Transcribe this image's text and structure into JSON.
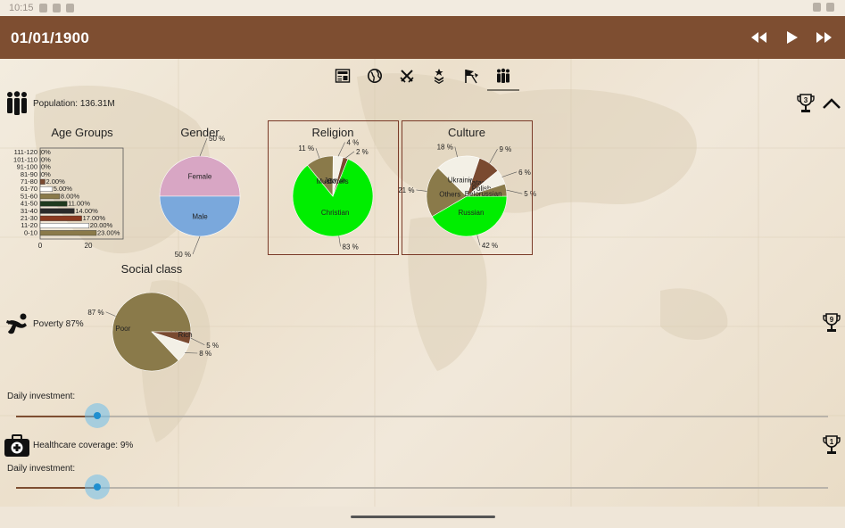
{
  "app_bar": {
    "date": "01/01/1900",
    "bg_color": "#7e4e31"
  },
  "status_bar": {
    "time": "10:15"
  },
  "tabs": [
    {
      "icon": "newspaper-icon"
    },
    {
      "icon": "globe-icon"
    },
    {
      "icon": "crossed-swords-icon"
    },
    {
      "icon": "military-rank-icon"
    },
    {
      "icon": "flags-icon"
    },
    {
      "icon": "people-icon",
      "active": true
    }
  ],
  "population": {
    "label": "Population: 136.31M",
    "trophy_rank": "3"
  },
  "poverty": {
    "label": "Poverty 87%",
    "trophy_rank": "9",
    "investment_label": "Daily investment:",
    "investment_level": 0.1
  },
  "healthcare": {
    "label": "Healthcare coverage: 9%",
    "trophy_rank": "1",
    "investment_label": "Daily investment:",
    "investment_level": 0.1
  },
  "chart_data": [
    {
      "type": "bar",
      "orientation": "horizontal",
      "title": "Age Groups",
      "categories": [
        "111-120",
        "101-110",
        "91-100",
        "81-90",
        "71-80",
        "61-70",
        "51-60",
        "41-50",
        "31-40",
        "21-30",
        "11-20",
        "0-10"
      ],
      "values": [
        0,
        0,
        0,
        0,
        2,
        5,
        8,
        11,
        14,
        17,
        20,
        23
      ],
      "value_labels": [
        "0%",
        "0%",
        "0%",
        "0%",
        "2.00%",
        "5.00%",
        "8.00%",
        "11.00%",
        "14.00%",
        "17.00%",
        "20.00%",
        "23.00%"
      ],
      "colors": [
        "#8a7a4a",
        "#ffffff",
        "#ffffff",
        "#8a7a4a",
        "#7a4a30",
        "#ffffff",
        "#8a7a4a",
        "#1f3a1f",
        "#2a2a2a",
        "#8a3a20",
        "#ffffff",
        "#8a7a4a"
      ],
      "xlim": [
        0,
        23
      ],
      "xticks": [
        "0",
        "20"
      ]
    },
    {
      "type": "pie",
      "title": "Gender",
      "labels": [
        "Female",
        "Male"
      ],
      "values": [
        50,
        50
      ],
      "value_labels": [
        "50 %",
        "50 %"
      ],
      "colors": [
        "#d8a6c4",
        "#7aa8dc"
      ]
    },
    {
      "type": "pie",
      "title": "Religion",
      "labels": [
        "Christian",
        "Muslim",
        "Jewish",
        "Others"
      ],
      "values": [
        83,
        11,
        4,
        2
      ],
      "value_labels": [
        "83 %",
        "11 %",
        "4 %",
        "2 %"
      ],
      "colors": [
        "#00ee00",
        "#8a7a4a",
        "#f3f0e6",
        "#7a4a30"
      ]
    },
    {
      "type": "pie",
      "title": "Culture",
      "labels": [
        "Russian",
        "Others",
        "Ukrainian",
        "Tatar",
        "Polish",
        "Belorussian"
      ],
      "values": [
        42,
        21,
        18,
        9,
        6,
        5
      ],
      "value_labels": [
        "42 %",
        "21 %",
        "18 %",
        "9 %",
        "6 %",
        "5 %"
      ],
      "colors": [
        "#00ee00",
        "#8a7a4a",
        "#f3f0e6",
        "#7a4a30",
        "#f3f0e6",
        "#8a7a4a"
      ]
    },
    {
      "type": "pie",
      "title": "Social class",
      "labels": [
        "Poor",
        "Middle",
        "Rich"
      ],
      "values": [
        87,
        8,
        5
      ],
      "value_labels": [
        "87 %",
        "8 %",
        "5 %"
      ],
      "colors": [
        "#8a7a4a",
        "#f3f0e6",
        "#7a4a30"
      ]
    }
  ]
}
